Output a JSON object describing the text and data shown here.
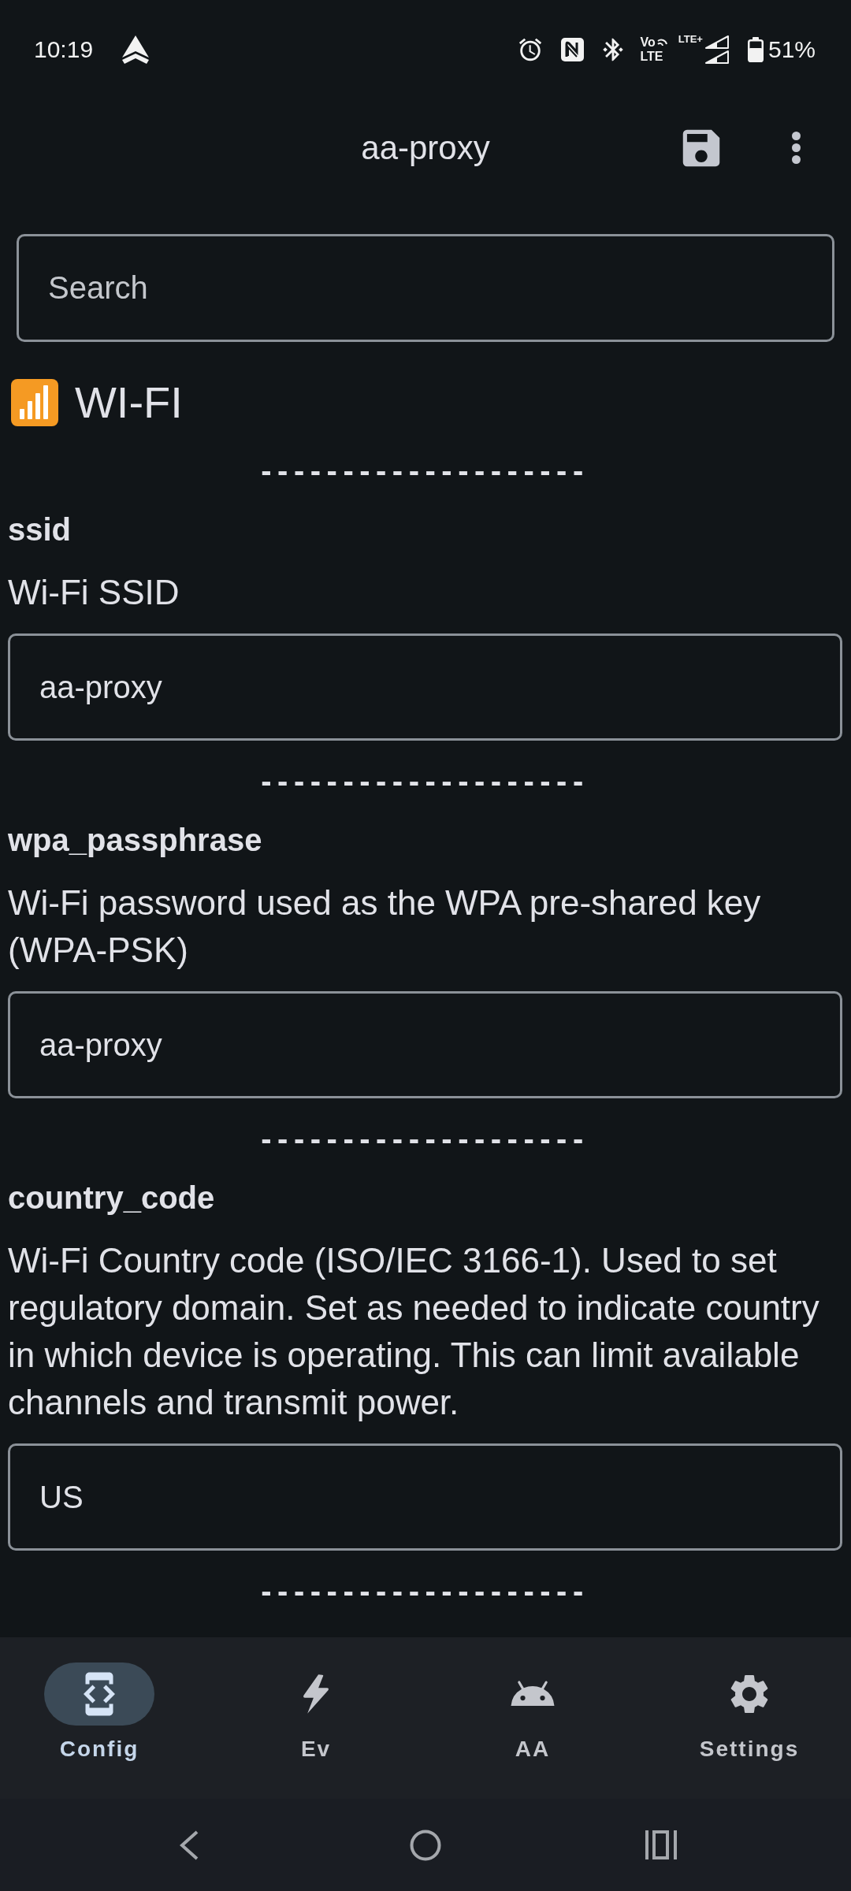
{
  "status_bar": {
    "time": "10:19",
    "volte": {
      "top": "Vo",
      "bottom": "LTE"
    },
    "network": "LTE+",
    "battery": "51%"
  },
  "app_bar": {
    "title": "aa-proxy"
  },
  "search": {
    "placeholder": "Search"
  },
  "section": {
    "title": "WI-FI",
    "items": [
      {
        "kind": "separator",
        "text": "--------------------"
      },
      {
        "kind": "setting",
        "name": "ssid",
        "description": "Wi-Fi SSID",
        "value": "aa-proxy"
      },
      {
        "kind": "separator",
        "text": "--------------------"
      },
      {
        "kind": "setting",
        "name": "wpa_passphrase",
        "description": "Wi-Fi password used as the WPA pre-shared key (WPA-PSK)",
        "value": "aa-proxy"
      },
      {
        "kind": "separator",
        "text": "--------------------"
      },
      {
        "kind": "setting",
        "name": "country_code",
        "description": "Wi-Fi Country code (ISO/IEC 3166-1). Used to set regulatory domain. Set as needed to indicate country in which device is operating. This can limit available channels and transmit power.",
        "value": "US"
      },
      {
        "kind": "separator",
        "text": "--------------------"
      }
    ]
  },
  "bottom_nav": [
    {
      "label": "Config",
      "selected": true
    },
    {
      "label": "Ev",
      "selected": false
    },
    {
      "label": "AA",
      "selected": false
    },
    {
      "label": "Settings",
      "selected": false
    }
  ]
}
